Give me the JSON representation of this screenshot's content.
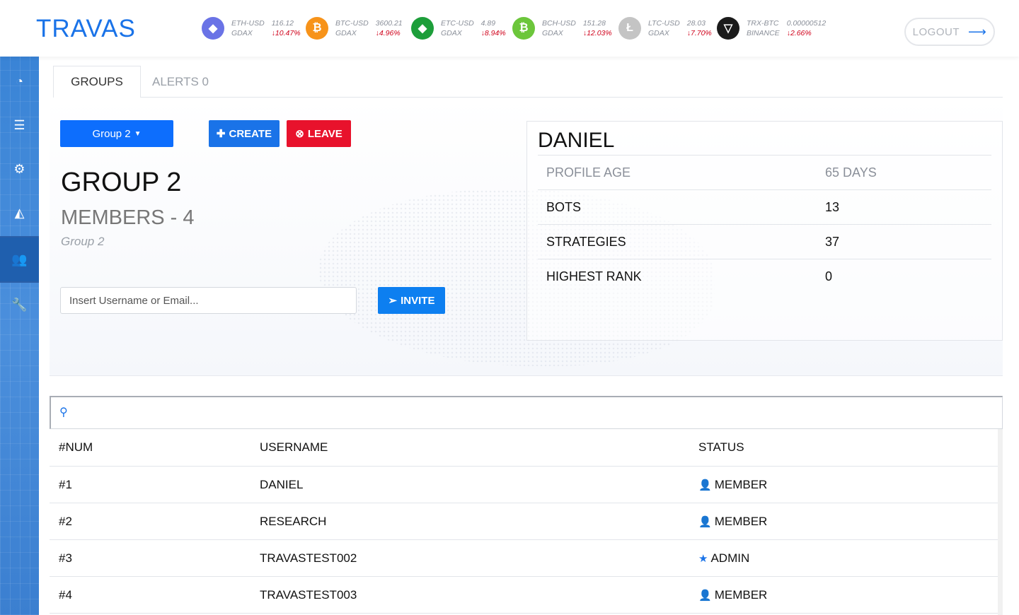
{
  "app": {
    "logo": "TRAVAS",
    "logout_label": "LOGOUT"
  },
  "tickers": [
    {
      "pair": "ETH-USD",
      "price": "116.12",
      "exchange": "GDAX",
      "change": "↓10.47%",
      "icon": "ethereum-icon",
      "color": "#6a73e6"
    },
    {
      "pair": "BTC-USD",
      "price": "3600.21",
      "exchange": "GDAX",
      "change": "↓4.96%",
      "icon": "bitcoin-icon",
      "color": "#f7931a"
    },
    {
      "pair": "ETC-USD",
      "price": "4.89",
      "exchange": "GDAX",
      "change": "↓8.94%",
      "icon": "ethereum-classic-icon",
      "color": "#1d9e3a"
    },
    {
      "pair": "BCH-USD",
      "price": "151.28",
      "exchange": "GDAX",
      "change": "↓12.03%",
      "icon": "bitcoin-cash-icon",
      "color": "#6cc63b"
    },
    {
      "pair": "LTC-USD",
      "price": "28.03",
      "exchange": "GDAX",
      "change": "↓7.70%",
      "icon": "litecoin-icon",
      "color": "#c4c4c4"
    },
    {
      "pair": "TRX-BTC",
      "price": "0.00000512",
      "exchange": "BINANCE",
      "change": "↓2.66%",
      "icon": "tron-icon",
      "color": "#1b1b1b"
    }
  ],
  "sidebar": [
    "dashboard-icon",
    "sliders-icon",
    "gears-icon",
    "area-chart-icon",
    "users-icon",
    "wrench-icon"
  ],
  "tabs": {
    "groups": "GROUPS",
    "alerts": "ALERTS 0"
  },
  "group": {
    "dropdown_label": "Group 2",
    "create_label": "CREATE",
    "leave_label": "LEAVE",
    "title": "GROUP 2",
    "members": "MEMBERS - 4",
    "subtitle": "Group 2",
    "invite_placeholder": "Insert Username or Email...",
    "invite_label": "INVITE"
  },
  "profile": {
    "name": "DANIEL",
    "rows": [
      {
        "key": "PROFILE AGE",
        "value": "65 DAYS"
      },
      {
        "key": "BOTS",
        "value": "13"
      },
      {
        "key": "STRATEGIES",
        "value": "37"
      },
      {
        "key": "HIGHEST RANK",
        "value": "0"
      }
    ]
  },
  "table": {
    "headers": [
      "#NUM",
      "USERNAME",
      "STATUS"
    ],
    "rows": [
      {
        "num": "#1",
        "username": "DANIEL",
        "status": "MEMBER",
        "icon": "user-icon"
      },
      {
        "num": "#2",
        "username": "RESEARCH",
        "status": "MEMBER",
        "icon": "user-icon"
      },
      {
        "num": "#3",
        "username": "TRAVASTEST002",
        "status": "ADMIN",
        "icon": "star-icon"
      },
      {
        "num": "#4",
        "username": "TRAVASTEST003",
        "status": "MEMBER",
        "icon": "user-icon"
      }
    ]
  }
}
